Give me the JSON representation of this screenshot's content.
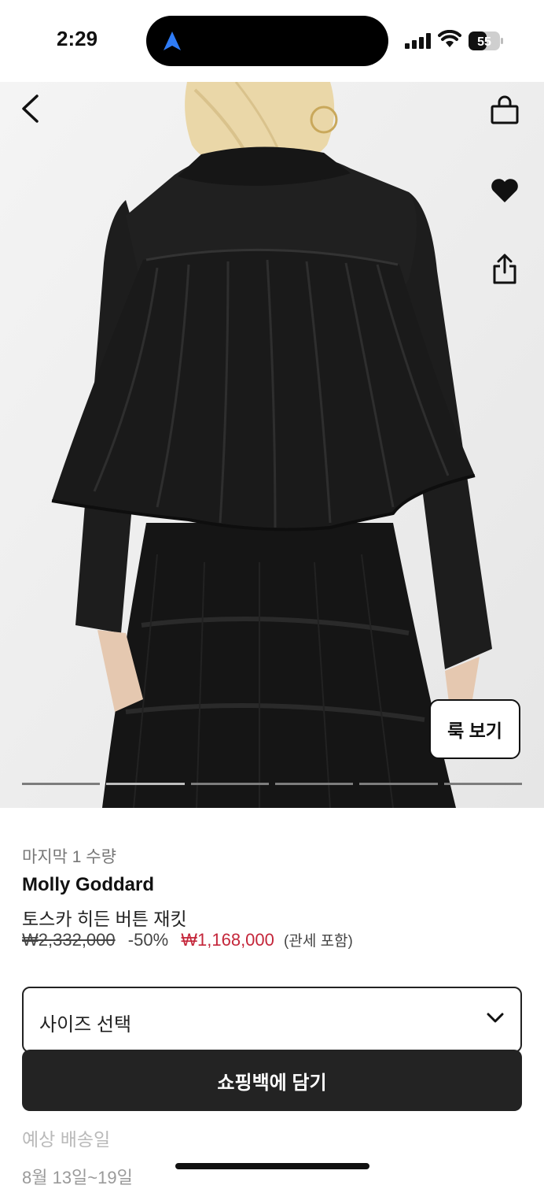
{
  "status_bar": {
    "time": "2:29",
    "battery": "55"
  },
  "product": {
    "stock_note": "마지막 1 수량",
    "brand": "Molly Goddard",
    "name": "토스카 히든 버튼 재킷",
    "original_price": "₩2,332,000",
    "discount": "-50%",
    "sale_price": "₩1,168,000",
    "duty_note": "(관세 포함)"
  },
  "gallery": {
    "look_button": "룩 보기",
    "slide_count": 6,
    "active_slide": 2
  },
  "size_select": {
    "placeholder": "사이즈 선택"
  },
  "add_to_bag_label": "쇼핑백에 담기",
  "delivery": {
    "label": "예상 배송일",
    "dates": "8월 13일~19일"
  },
  "icons": {
    "back": "chevron-left-icon",
    "bag": "shopping-bag-icon",
    "wishlist": "heart-icon",
    "share": "share-icon",
    "size_dropdown": "chevron-down-icon"
  },
  "colors": {
    "sale_price": "#c4263a",
    "button_bg": "#232323",
    "location_arrow": "#2f7cf6"
  }
}
